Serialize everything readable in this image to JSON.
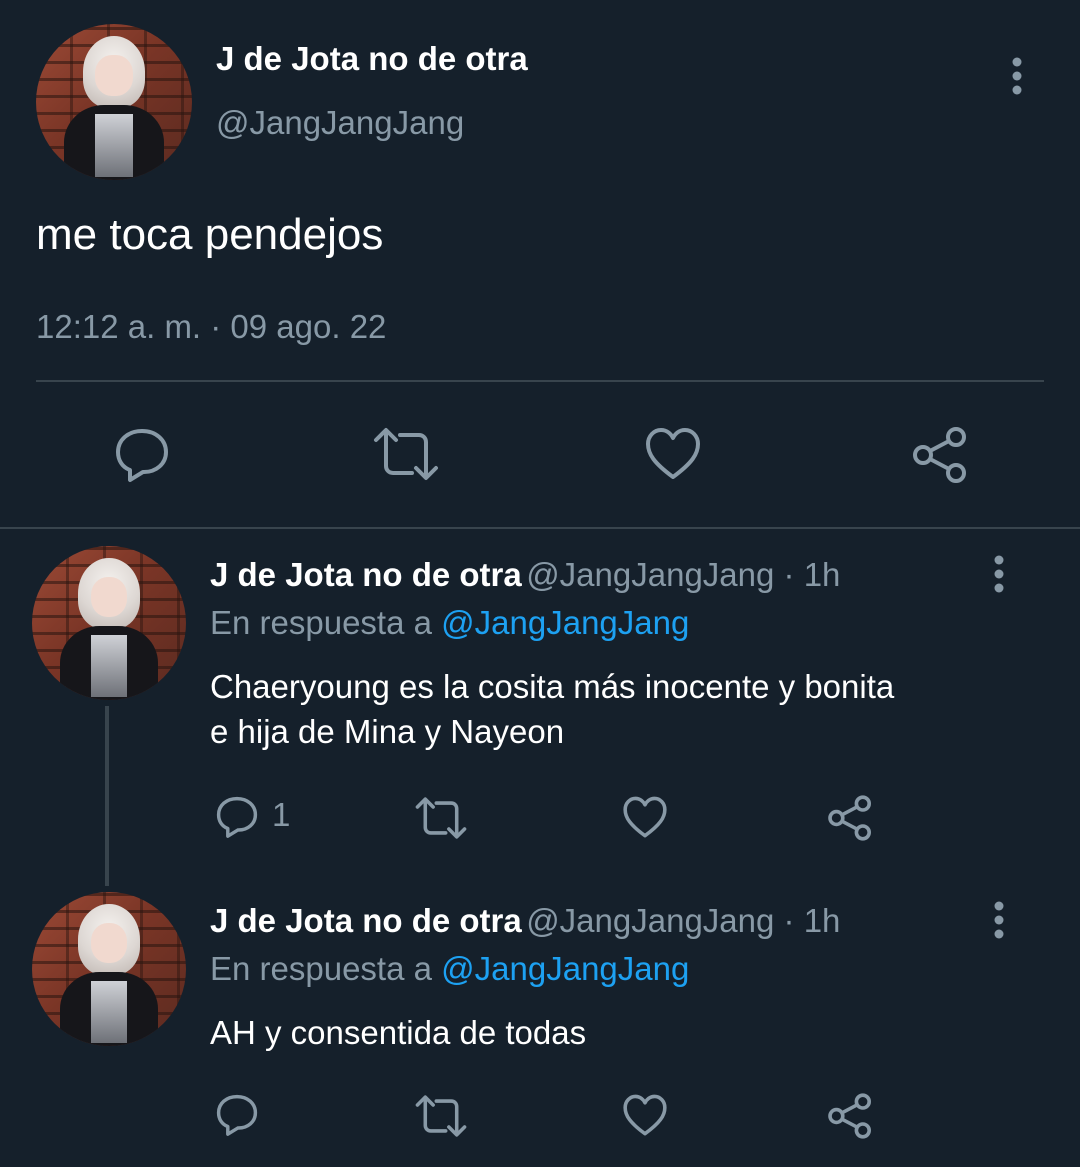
{
  "main_tweet": {
    "name": "J de Jota no de otra",
    "handle": "@JangJangJang",
    "text": "me toca pendejos",
    "timestamp": "12:12 a. m. · 09 ago. 22"
  },
  "replies": [
    {
      "name": "J de Jota no de otra",
      "handle": "@JangJangJang · 1h",
      "reply_prefix": "En respuesta a ",
      "reply_to": "@JangJangJang",
      "text_line1": "Chaeryoung es la cosita más inocente y bonita",
      "text_line2": "e hija de Mina y Nayeon",
      "reply_count": "1"
    },
    {
      "name": "J de Jota no de otra",
      "handle": "@JangJangJang · 1h",
      "reply_prefix": "En respuesta a ",
      "reply_to": "@JangJangJang",
      "text_line1": "AH y consentida de todas"
    }
  ],
  "icons": {
    "more": "more-vertical-icon",
    "reply": "reply-icon",
    "retweet": "retweet-icon",
    "like": "heart-icon",
    "share": "share-icon"
  },
  "colors": {
    "background": "#15202b",
    "text": "#ffffff",
    "secondary": "#8899a6",
    "accent": "#1da1f2",
    "divider": "#38444d"
  }
}
